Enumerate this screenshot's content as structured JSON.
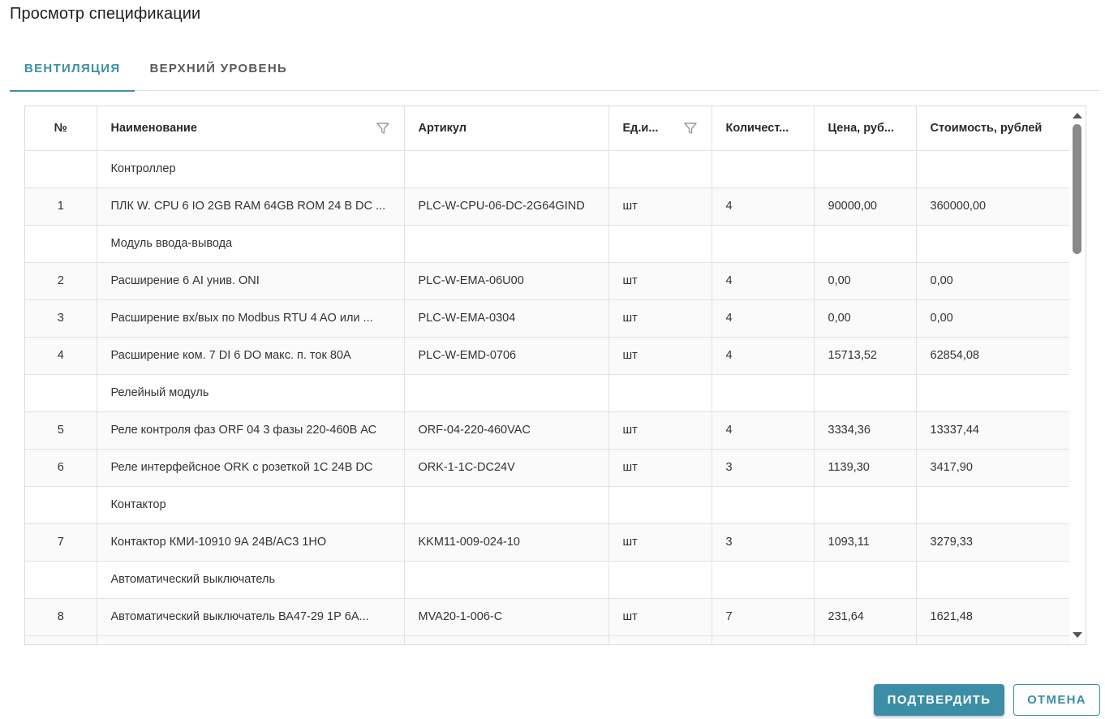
{
  "dialog": {
    "title": "Просмотр спецификации"
  },
  "tabs": [
    {
      "label": "ВЕНТИЛЯЦИЯ",
      "active": true
    },
    {
      "label": "ВЕРХНИЙ УРОВЕНЬ",
      "active": false
    }
  ],
  "table": {
    "columns": [
      {
        "label": "№",
        "filter": false
      },
      {
        "label": "Наименование",
        "filter": true
      },
      {
        "label": "Артикул",
        "filter": false
      },
      {
        "label": "Ед.и...",
        "filter": true
      },
      {
        "label": "Количест...",
        "filter": false
      },
      {
        "label": "Цена, руб...",
        "filter": false
      },
      {
        "label": "Стоимость, рублей",
        "filter": false
      }
    ],
    "rows": [
      {
        "group": "Контроллер"
      },
      {
        "n": "1",
        "name": "ПЛК W. CPU 6 IO 2GB RAM 64GB ROM 24 В DC ...",
        "article": "PLC-W-CPU-06-DC-2G64GIND",
        "unit": "шт",
        "qty": "4",
        "price": "90000,00",
        "cost": "360000,00"
      },
      {
        "group": "Модуль ввода-вывода"
      },
      {
        "n": "2",
        "name": "Расширение 6 AI унив. ONI",
        "article": "PLC-W-EMA-06U00",
        "unit": "шт",
        "qty": "4",
        "price": "0,00",
        "cost": "0,00"
      },
      {
        "n": "3",
        "name": "Расширение вх/вых по Modbus RTU 4 AO или ...",
        "article": "PLC-W-EMA-0304",
        "unit": "шт",
        "qty": "4",
        "price": "0,00",
        "cost": "0,00"
      },
      {
        "n": "4",
        "name": "Расширение ком. 7 DI 6 DO макс. п. ток 80А",
        "article": "PLC-W-EMD-0706",
        "unit": "шт",
        "qty": "4",
        "price": "15713,52",
        "cost": "62854,08"
      },
      {
        "group": "Релейный модуль"
      },
      {
        "n": "5",
        "name": "Реле контроля фаз ORF 04 3 фазы 220-460В АС",
        "article": "ORF-04-220-460VAC",
        "unit": "шт",
        "qty": "4",
        "price": "3334,36",
        "cost": "13337,44"
      },
      {
        "n": "6",
        "name": "Реле интерфейсное ORK с розеткой 1С 24В DC",
        "article": "ORK-1-1C-DC24V",
        "unit": "шт",
        "qty": "3",
        "price": "1139,30",
        "cost": "3417,90"
      },
      {
        "group": "Контактор"
      },
      {
        "n": "7",
        "name": "Контактор КМИ-10910 9А 24В/АС3 1НО",
        "article": "KKM11-009-024-10",
        "unit": "шт",
        "qty": "3",
        "price": "1093,11",
        "cost": "3279,33"
      },
      {
        "group": "Автоматический выключатель"
      },
      {
        "n": "8",
        "name": "Автоматический выключатель ВА47-29 1Р 6А...",
        "article": "MVA20-1-006-C",
        "unit": "шт",
        "qty": "7",
        "price": "231,64",
        "cost": "1621,48"
      },
      {
        "n": "",
        "name": "",
        "article": "",
        "unit": "",
        "qty": "",
        "price": "",
        "cost": ""
      }
    ]
  },
  "buttons": {
    "confirm": "ПОДТВЕРДИТЬ",
    "cancel": "ОТМЕНА"
  },
  "colors": {
    "accent": "#3b8ea5",
    "border": "#e2e2e2"
  }
}
